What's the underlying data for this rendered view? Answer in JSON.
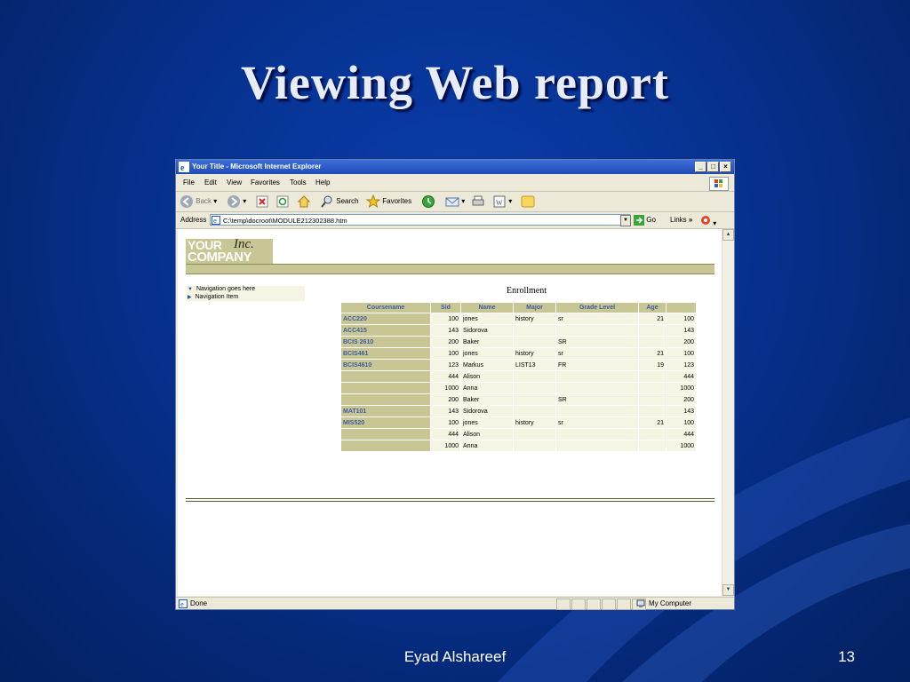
{
  "slide": {
    "title": "Viewing Web report",
    "author": "Eyad Alshareef",
    "page_number": "13"
  },
  "browser": {
    "window_title": "Your Title - Microsoft Internet Explorer",
    "window_buttons": [
      "_",
      "□",
      "×"
    ],
    "menu": [
      "File",
      "Edit",
      "View",
      "Favorites",
      "Tools",
      "Help"
    ],
    "toolbar": {
      "back": "Back",
      "search": "Search",
      "favorites": "Favorites"
    },
    "address_label": "Address",
    "address_value": "C:\\temp\\docroot\\MODULE212302388.htm",
    "go_label": "Go",
    "links_label": "Links",
    "status_text": "Done",
    "zone_text": "My Computer"
  },
  "page": {
    "logo": {
      "line1": "YOUR",
      "inc": "Inc.",
      "line2": "COMPANY"
    },
    "nav": [
      "Navigation goes here",
      "Navigation Item"
    ],
    "report_title": "Enrollment",
    "columns": [
      "Coursename",
      "Sid",
      "Name",
      "Major",
      "Grade Level",
      "Age",
      ""
    ],
    "rows": [
      [
        "ACC220",
        "100",
        "jones",
        "history",
        "sr",
        "21",
        "100"
      ],
      [
        "ACC415",
        "143",
        "Sidorova",
        "",
        "",
        "",
        "143"
      ],
      [
        "BCIS 2610",
        "200",
        "Baker",
        "",
        "SR",
        "",
        "200"
      ],
      [
        "BCIS461",
        "100",
        "jones",
        "history",
        "sr",
        "21",
        "100"
      ],
      [
        "BCIS4610",
        "123",
        "Markus",
        "LIST13",
        "FR",
        "19",
        "123"
      ],
      [
        "",
        "444",
        "Alison",
        "",
        "",
        "",
        "444"
      ],
      [
        "",
        "1000",
        "Anna",
        "",
        "",
        "",
        "1000"
      ],
      [
        "",
        "200",
        "Baker",
        "",
        "SR",
        "",
        "200"
      ],
      [
        "MAT101",
        "143",
        "Sidorova",
        "",
        "",
        "",
        "143"
      ],
      [
        "MIS520",
        "100",
        "jones",
        "history",
        "sr",
        "21",
        "100"
      ],
      [
        "",
        "444",
        "Alison",
        "",
        "",
        "",
        "444"
      ],
      [
        "",
        "1000",
        "Anna",
        "",
        "",
        "",
        "1000"
      ]
    ]
  },
  "colors": {
    "slide_bg": "#06318f",
    "report_accent": "#c9c696",
    "course_text": "#3d5c9b",
    "row_bg": "#f6f5e4"
  }
}
